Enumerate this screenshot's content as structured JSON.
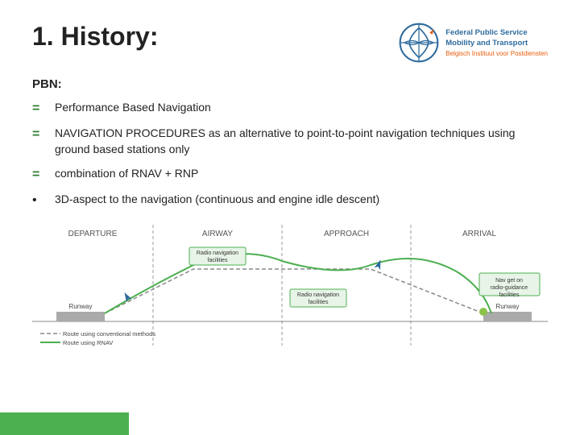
{
  "title": "1. History:",
  "logo": {
    "line1": "Federal Public Service",
    "line2": "Mobility and Transport",
    "line3": "Belgisch Instituut voor Postdiensten"
  },
  "pbn_label": "PBN:",
  "items": [
    {
      "type": "eq",
      "text": "Performance Based Navigation"
    },
    {
      "type": "eq",
      "text": "NAVIGATION PROCEDURES as an alternative to point-to-point navigation techniques using ground based stations only"
    },
    {
      "type": "eq",
      "text": "combination of RNAV + RNP"
    },
    {
      "type": "bullet",
      "text": "3D-aspect to the navigation (continuous and engine idle descent)"
    }
  ],
  "diagram": {
    "labels": [
      "DEPARTURE",
      "AIRWAY",
      "APPROACH",
      "ARRIVAL"
    ],
    "sublabels": [
      "",
      "Radio navigation facilities",
      "Radio navigation facilities",
      "Nav get on radio-guidance facilities"
    ],
    "legend": [
      "Route using conventional methods",
      "Route using RNAV"
    ]
  }
}
